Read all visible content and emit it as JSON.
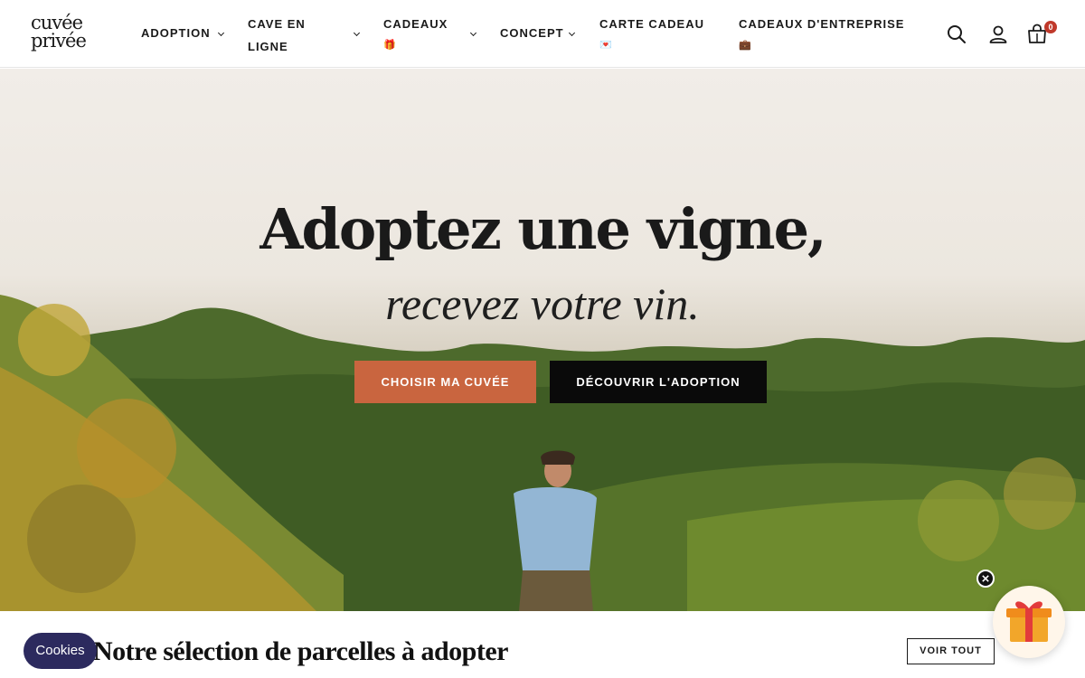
{
  "brand": {
    "logo_line1": "cuvée",
    "logo_line2": "privée"
  },
  "nav": {
    "adoption": "ADOPTION",
    "cave": "CAVE EN LIGNE",
    "cadeaux": "CADEAUX",
    "cadeaux_emoji": "🎁",
    "concept": "CONCEPT",
    "carte_cadeau": "CARTE CADEAU",
    "carte_cadeau_emoji": "💌",
    "entreprise": "CADEAUX D'ENTREPRISE",
    "entreprise_emoji": "💼"
  },
  "header_icons": [
    "search-icon",
    "account-icon",
    "cart-icon"
  ],
  "cart": {
    "count": "0"
  },
  "hero": {
    "title": "Adoptez une vigne,",
    "subtitle": "recevez votre vin.",
    "primary_cta": "CHOISIR MA CUVÉE",
    "secondary_cta": "DÉCOUVRIR L'ADOPTION"
  },
  "section": {
    "title": "Notre sélection de parcelles à adopter",
    "voir_tout": "VOIR TOUT"
  },
  "cookies": {
    "label": "Cookies"
  },
  "colors": {
    "accent": "#c9653f",
    "dark": "#0a0a0a",
    "cookies_bg": "#2c2a5e",
    "badge": "#c0392b"
  }
}
